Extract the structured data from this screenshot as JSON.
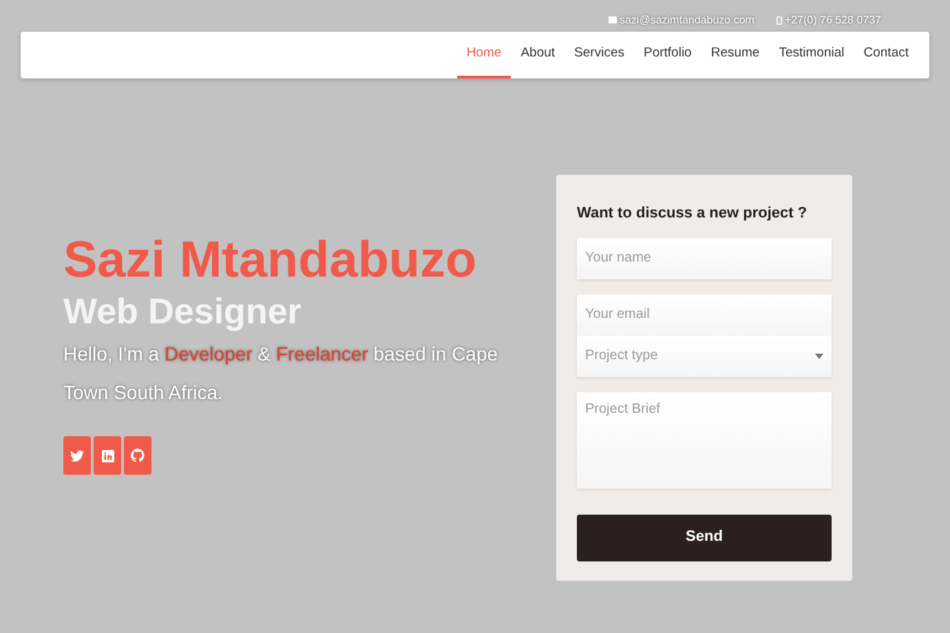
{
  "topbar": {
    "email": "sazi@sazimtandabuzo.com",
    "phone": "+27(0) 76 528 0737"
  },
  "nav": [
    {
      "label": "Home",
      "selected": true
    },
    {
      "label": "About",
      "selected": false
    },
    {
      "label": "Services",
      "selected": false
    },
    {
      "label": "Portfolio",
      "selected": false
    },
    {
      "label": "Resume",
      "selected": false
    },
    {
      "label": "Testimonial",
      "selected": false
    },
    {
      "label": "Contact",
      "selected": false
    }
  ],
  "hero": {
    "name": "Sazi Mtandabuzo",
    "role": "Web Designer",
    "intro": [
      {
        "text": "Hello, I'm a ",
        "highlight": false
      },
      {
        "text": "Developer",
        "highlight": true
      },
      {
        "text": " & ",
        "highlight": false
      },
      {
        "text": "Freelancer",
        "highlight": true
      },
      {
        "text": " based in Cape Town South Africa.",
        "highlight": false
      }
    ],
    "social": [
      {
        "kind": "twitter"
      },
      {
        "kind": "linkedin"
      },
      {
        "kind": "github"
      }
    ]
  },
  "form": {
    "title": "Want to discuss a new project ?",
    "fields": [
      {
        "kind": "text",
        "placeholder": "Your name"
      },
      {
        "kind": "email",
        "placeholder": "Your email"
      },
      {
        "kind": "select",
        "placeholder": "Project type"
      },
      {
        "kind": "textarea",
        "placeholder": "Project Brief"
      }
    ],
    "button": "Send"
  }
}
